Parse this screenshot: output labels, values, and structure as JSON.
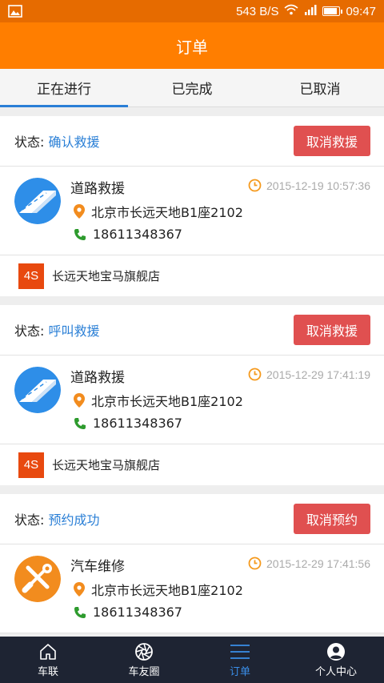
{
  "statusbar": {
    "speed": "543 B/S",
    "time": "09:47",
    "battery_level": 0.85
  },
  "header": {
    "title": "订单"
  },
  "tabs": [
    {
      "label": "正在进行",
      "active": true
    },
    {
      "label": "已完成",
      "active": false
    },
    {
      "label": "已取消",
      "active": false
    }
  ],
  "status_prefix": "状态:",
  "orders": [
    {
      "status": "确认救援",
      "button": "取消救援",
      "service": "道路救援",
      "icon": "road-icon",
      "time": "2015-12-19 10:57:36",
      "address": "北京市长远天地B1座2102",
      "phone": "18611348367",
      "shop_badge": "4S",
      "shop": "长远天地宝马旗舰店"
    },
    {
      "status": "呼叫救援",
      "button": "取消救援",
      "service": "道路救援",
      "icon": "road-icon",
      "time": "2015-12-29 17:41:19",
      "address": "北京市长远天地B1座2102",
      "phone": "18611348367",
      "shop_badge": "4S",
      "shop": "长远天地宝马旗舰店"
    },
    {
      "status": "预约成功",
      "button": "取消预约",
      "service": "汽车维修",
      "icon": "repair-tools-icon",
      "time": "2015-12-29 17:41:56",
      "address": "北京市长远天地B1座2102",
      "phone": "18611348367"
    }
  ],
  "bottom_nav": [
    {
      "label": "车联",
      "icon": "home-icon",
      "active": false
    },
    {
      "label": "车友圈",
      "icon": "aperture-icon",
      "active": false
    },
    {
      "label": "订单",
      "icon": "list-icon",
      "active": true
    },
    {
      "label": "个人中心",
      "icon": "user-icon",
      "active": false
    }
  ],
  "colors": {
    "brand_orange": "#ff7e00",
    "status_blue": "#2a7fd6",
    "button_red": "#e05050",
    "nav_bg": "#1e2433",
    "badge_4s": "#e8490f"
  }
}
